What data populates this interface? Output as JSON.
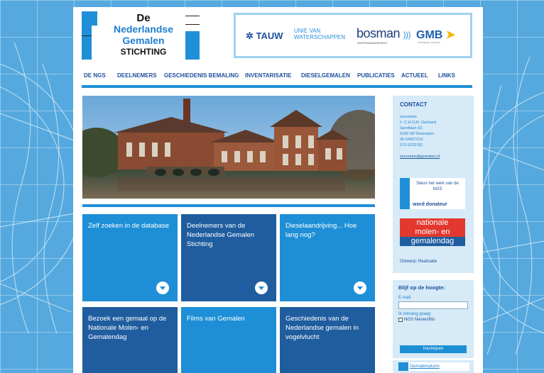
{
  "logo": {
    "line1": "De",
    "line2": "Nederlandse",
    "line3": "Gemalen",
    "line4": "STICHTING"
  },
  "sponsors": {
    "tauw": "TAUW",
    "unie_line1": "UNIE VAN",
    "unie_line2": "WATERSCHAPPEN",
    "bosman": "bosman",
    "bosman_sub": "WATERMANAGEMENT",
    "gmb": "GMB",
    "gmb_sub": "uitdaging centraal"
  },
  "nav": {
    "items": [
      "DE NGS",
      "DEELNEMERS",
      "GESCHIEDENIS BEMALING",
      "INVENTARISATIE",
      "DIESELGEMALEN",
      "PUBLICATIES",
      "ACTUEEL",
      "LINKS"
    ]
  },
  "tiles": [
    {
      "text": "Zelf zoeken in de database"
    },
    {
      "text": "Deelnemers van de Nederlandse Gemalen Stichting"
    },
    {
      "text": "Dieselaandrijving... Hoe lang nog?"
    },
    {
      "text": "Bezoek een gemaal op de Nationale Molen- en Gemalendag"
    },
    {
      "text": "Films van Gemalen"
    },
    {
      "text": "Geschiedenis van de Nederlandse gemalen in vogelvlucht"
    }
  ],
  "contact": {
    "title": "CONTACT",
    "role": "secretaris",
    "name": "Ir. C.H.S.M. Geelaert",
    "street": "Sportlaan 63,",
    "city": "5242 GP Rosmalen",
    "phone1": "06-54657019",
    "phone2": "073-5220781",
    "email": "secretaris@gemalen.nl"
  },
  "promo": {
    "steun": "Steun het werk van de NGS",
    "donateur": "word donateur",
    "molen1": "nationale",
    "molen2": "molen- en",
    "molen3": "gemalendag",
    "ontwerp": "Ontwerp: Realisatie"
  },
  "newsletter": {
    "title": "Blijf op de hoogte:",
    "email_label": "E-mail:",
    "ontvang_label": "Ik ontvang graag:",
    "option": "NGS Nieuwsflits",
    "button": "Inschrijven"
  },
  "pluim": {
    "label": "Gemalenpluim"
  },
  "colors": {
    "accent": "#1e8fd6",
    "dark_tile": "#1f5d9f",
    "nav_text": "#1e4f9c",
    "sidebar_bg": "#d6eaf7"
  }
}
